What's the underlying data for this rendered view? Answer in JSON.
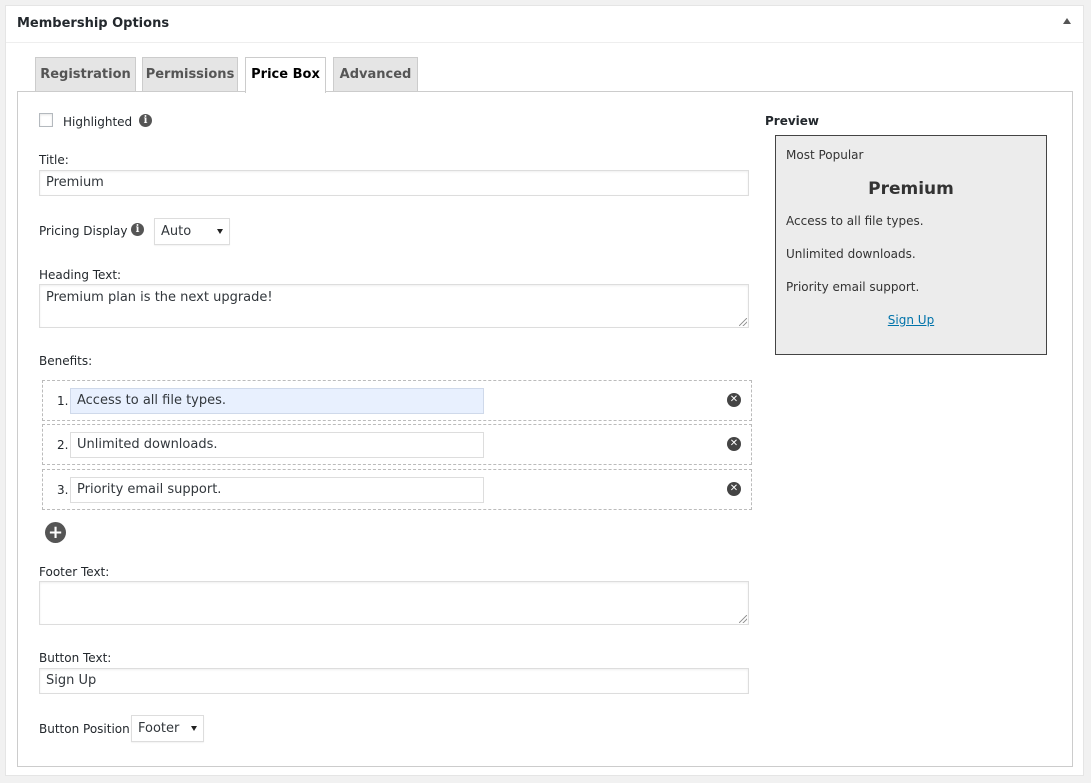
{
  "postbox": {
    "title": "Membership Options"
  },
  "tabs": [
    {
      "label": "Registration"
    },
    {
      "label": "Permissions"
    },
    {
      "label": "Price Box"
    },
    {
      "label": "Advanced"
    }
  ],
  "form": {
    "highlighted_label": "Highlighted",
    "highlighted_checked": false,
    "title_label": "Title:",
    "title_value": "Premium",
    "pricing_display_label": "Pricing Display",
    "pricing_display_value": "Auto",
    "heading_text_label": "Heading Text:",
    "heading_text_value": "Premium plan is the next upgrade!",
    "benefits_label": "Benefits:",
    "benefits": [
      {
        "num": "1.",
        "value": "Access to all file types."
      },
      {
        "num": "2.",
        "value": "Unlimited downloads."
      },
      {
        "num": "3.",
        "value": "Priority email support."
      }
    ],
    "footer_text_label": "Footer Text:",
    "footer_text_value": "",
    "button_text_label": "Button Text:",
    "button_text_value": "Sign Up",
    "button_position_label": "Button Position",
    "button_position_value": "Footer"
  },
  "preview": {
    "label": "Preview",
    "badge": "Most Popular",
    "title": "Premium",
    "benefits": [
      "Access to all file types.",
      "Unlimited downloads.",
      "Priority email support."
    ],
    "button": "Sign Up"
  },
  "icons": {
    "info": "info-icon",
    "remove": "remove-circle-icon",
    "add": "add-circle-icon",
    "collapse": "collapse-arrow-icon"
  }
}
